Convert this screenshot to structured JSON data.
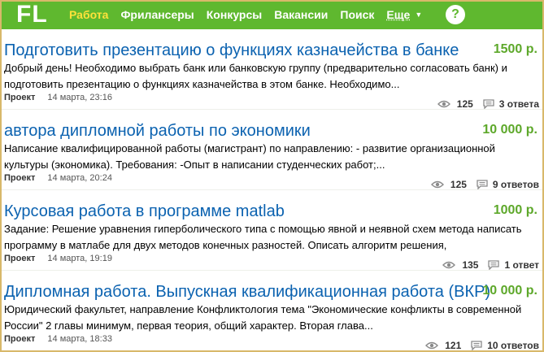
{
  "header": {
    "logo": "FL",
    "nav": [
      "Работа",
      "Фрилансеры",
      "Конкурсы",
      "Вакансии",
      "Поиск"
    ],
    "more_label": "Еще",
    "help_label": "?"
  },
  "projects": [
    {
      "title": "Подготовить презентацию о функциях казначейства в банке",
      "price": "1500 р.",
      "description": "Добрый день! Необходимо выбрать банк или банковскую группу (предварительно согласовать банк) и подготовить презентацию о функциях казначейства в этом банке. Необходимо...",
      "kind": "Проект",
      "date": "14 марта, 23:16",
      "views": "125",
      "answers": "3 ответа"
    },
    {
      "title": "автора дипломной работы по экономики",
      "price": "10 000 р.",
      "description": "Написание квалифицированной работы (магистрант) по направлению:  - развитие организационной культуры (экономика).  Требования:   -Опыт в написании студенческих работ;...",
      "kind": "Проект",
      "date": "14 марта, 20:24",
      "views": "125",
      "answers": "9 ответов"
    },
    {
      "title": "Курсовая работа в программе matlab",
      "price": "1000 р.",
      "description": "Задание: Решение уравнения гиперболического типа с помощью явной и неявной схем метода написать программу в матлабе для двух методов конечных разностей. Описать алгоритм решения,",
      "kind": "Проект",
      "date": "14 марта, 19:19",
      "views": "135",
      "answers": "1 ответ"
    },
    {
      "title": "Дипломная работа. Выпускная квалификационная работа (ВКР)",
      "price": "10 000 р.",
      "description": "Юридический факультет, направление Конфликтология тема \"Экономические конфликты в современной России\" 2 главы минимум, первая теория, общий характер. Вторая глава...",
      "kind": "Проект",
      "date": "14 марта, 18:33",
      "views": "121",
      "answers": "10 ответов"
    }
  ]
}
